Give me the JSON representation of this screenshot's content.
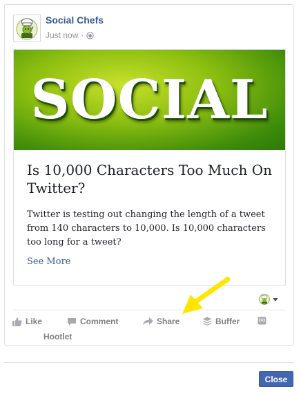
{
  "post": {
    "page_name": "Social Chefs",
    "timestamp": "Just now",
    "separator": "·",
    "privacy_icon": "globe-icon",
    "avatar_icon": "chef-mascot-icon"
  },
  "link_preview": {
    "image_text": "SOCIAL",
    "title": "Is 10,000 Characters Too Much On Twitter?",
    "description": "Twitter is testing out changing the length of a tweet from 140 characters to 10,000. Is 10,000 characters too long for a tweet?",
    "see_more": "See More",
    "colors": {
      "image_light": "#c8e02c",
      "image_dark": "#2c7a08"
    }
  },
  "actions": {
    "like": "Like",
    "comment": "Comment",
    "share": "Share",
    "buffer": "Buffer",
    "hootlet": "Hootlet"
  },
  "dialog": {
    "close_label": "Close"
  },
  "colors": {
    "link_blue": "#365899",
    "button_blue": "#4267b2",
    "action_gray": "#7f7f7f",
    "annotation_yellow": "#ffe600"
  }
}
